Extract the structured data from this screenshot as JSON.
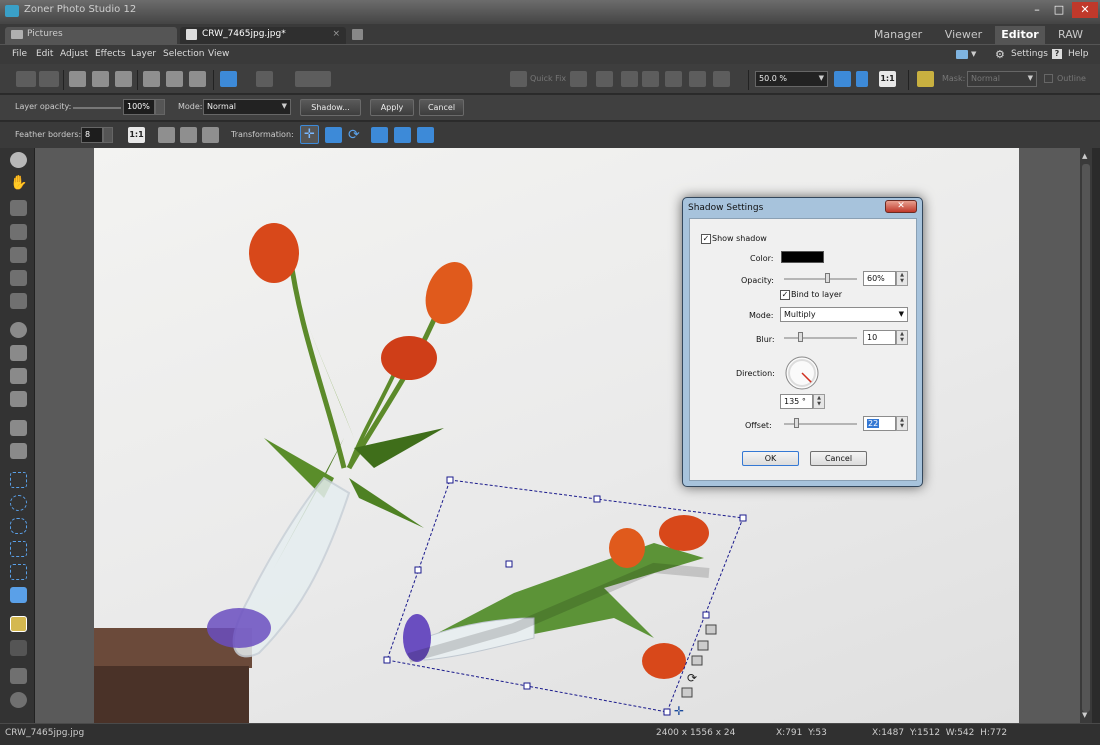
{
  "window": {
    "title": "Zoner Photo Studio 12",
    "minimize": "–",
    "maximize": "□",
    "close": "✕"
  },
  "tabs": [
    {
      "label": "Pictures",
      "active": false
    },
    {
      "label": "CRW_7465jpg.jpg*",
      "active": true,
      "close": "×"
    }
  ],
  "modes": {
    "manager": "Manager",
    "viewer": "Viewer",
    "editor": "Editor",
    "raw": "RAW",
    "active": "Editor"
  },
  "menu": [
    "File",
    "Edit",
    "Adjust",
    "Effects",
    "Layer",
    "Selection",
    "View"
  ],
  "menu_right": {
    "settings": "Settings",
    "help": "Help"
  },
  "toolbar": {
    "quick_fix": "Quick Fix",
    "zoom": "50.0 %",
    "one_to_one": "1:1",
    "mask": "Mask:",
    "mask_mode": "Normal",
    "outline": "Outline"
  },
  "layer_options": {
    "opacity_label": "Layer opacity:",
    "opacity_value": "100%",
    "opacity_fraction": 1.0,
    "mode_label": "Mode:",
    "mode_value": "Normal",
    "shadow_button": "Shadow...",
    "apply_button": "Apply",
    "cancel_button": "Cancel"
  },
  "transform_bar": {
    "feather_label": "Feather borders:",
    "feather_value": "8",
    "one_to_one": "1:1",
    "transformation_label": "Transformation:"
  },
  "dialog": {
    "title": "Shadow Settings",
    "show_shadow_label": "Show shadow",
    "show_shadow_checked": true,
    "color_label": "Color:",
    "color_value": "#000000",
    "opacity_label": "Opacity:",
    "opacity_value": "60%",
    "opacity_fraction": 0.6,
    "bind_label": "Bind to layer",
    "bind_checked": true,
    "mode_label": "Mode:",
    "mode_value": "Multiply",
    "blur_label": "Blur:",
    "blur_value": "10",
    "direction_label": "Direction:",
    "direction_value": "135 °",
    "direction_degrees": 135,
    "offset_label": "Offset:",
    "offset_value": "22",
    "ok_button": "OK",
    "cancel_button": "Cancel"
  },
  "status": {
    "filename": "CRW_7465jpg.jpg",
    "dimensions": "2400 x 1556 x 24",
    "cursor": "X:791  Y:53",
    "selection": "X:1487  Y:1512  W:542  H:772"
  },
  "colors": {
    "accent": "#3d8ad8",
    "dialog_frame": "#a7c3dc",
    "selection": "#1a1a8c"
  }
}
